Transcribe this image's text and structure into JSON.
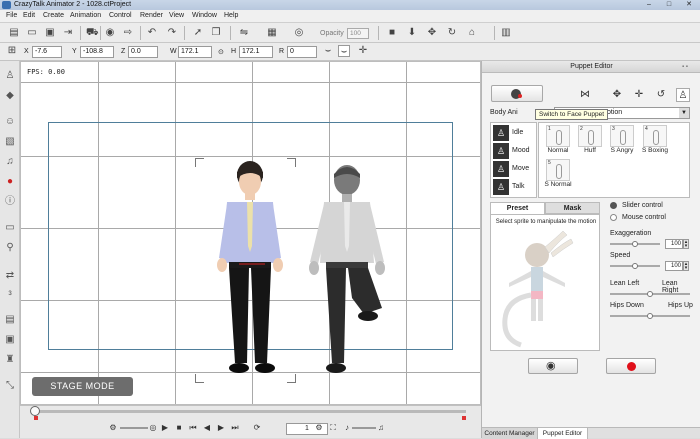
{
  "window": {
    "title": "CrazyTalk Animator 2  -  1028.ctProject",
    "minimize": "–",
    "maximize": "□",
    "close": "✕"
  },
  "menu": [
    "File",
    "Edit",
    "Create",
    "Animation",
    "Control",
    "Render",
    "View",
    "Window",
    "Help"
  ],
  "toolbar": {
    "opacity_label": "Opacity",
    "opacity_value": "100",
    "icons": [
      "new-icon",
      "open-icon",
      "save-icon",
      "import-icon",
      "store-icon",
      "preview-icon",
      "export-icon",
      "undo-icon",
      "redo-icon",
      "select-icon",
      "group-icon",
      "flip-icon",
      "layer-icon",
      "visibility-icon",
      "camera-icon",
      "move-down-icon",
      "move-icon",
      "rotate-icon",
      "home-icon",
      "timeline-icon"
    ]
  },
  "transform": {
    "x_label": "X",
    "x_value": "-7.6",
    "y_label": "Y",
    "y_value": "-108.8",
    "z_label": "Z",
    "z_value": "0.0",
    "w_label": "W",
    "w_value": "172.1",
    "h_label": "H",
    "h_value": "172.1",
    "r_label": "R",
    "r_value": "0"
  },
  "stage": {
    "fps": "FPS: 0.00",
    "mode_button": "STAGE MODE"
  },
  "timeline": {
    "frame": "1"
  },
  "puppet_editor": {
    "title": "Puppet Editor",
    "tooltip": "Switch to Face Puppet",
    "body_anim_label": "Body Ani",
    "motion_select": "otion",
    "categories": [
      {
        "label": "Idle",
        "icon": "idle-icon"
      },
      {
        "label": "Mood",
        "icon": "mood-icon"
      },
      {
        "label": "Move",
        "icon": "move-motion-icon"
      },
      {
        "label": "Talk",
        "icon": "talk-icon"
      }
    ],
    "motions": [
      {
        "number": "1",
        "label": "Normal"
      },
      {
        "number": "2",
        "label": "Huff"
      },
      {
        "number": "3",
        "label": "S Angry"
      },
      {
        "number": "4",
        "label": "S Boxing"
      },
      {
        "number": "5",
        "label": "S Normal"
      }
    ],
    "tabs": {
      "preset": "Preset",
      "mask": "Mask"
    },
    "sprite_hint": "Select sprite to manipulate the motion",
    "slider_control": "Slider control",
    "mouse_control": "Mouse control",
    "exaggeration_label": "Exaggeration",
    "exaggeration_value": "100",
    "exaggeration_level": 0.5,
    "speed_label": "Speed",
    "speed_value": "100",
    "speed_level": 0.5,
    "lean_left": "Lean Left",
    "lean_right": "Lean Right",
    "lean_level": 0.5,
    "hips_down": "Hips Down",
    "hips_up": "Hips Up",
    "hips_level": 0.5
  },
  "bottom_tabs": [
    "Content Manager",
    "Puppet Editor"
  ],
  "colors": {
    "record": "#e0101a",
    "frame_border": "#4f7e9a",
    "stage_mode_bg": "#6d6d6d"
  }
}
